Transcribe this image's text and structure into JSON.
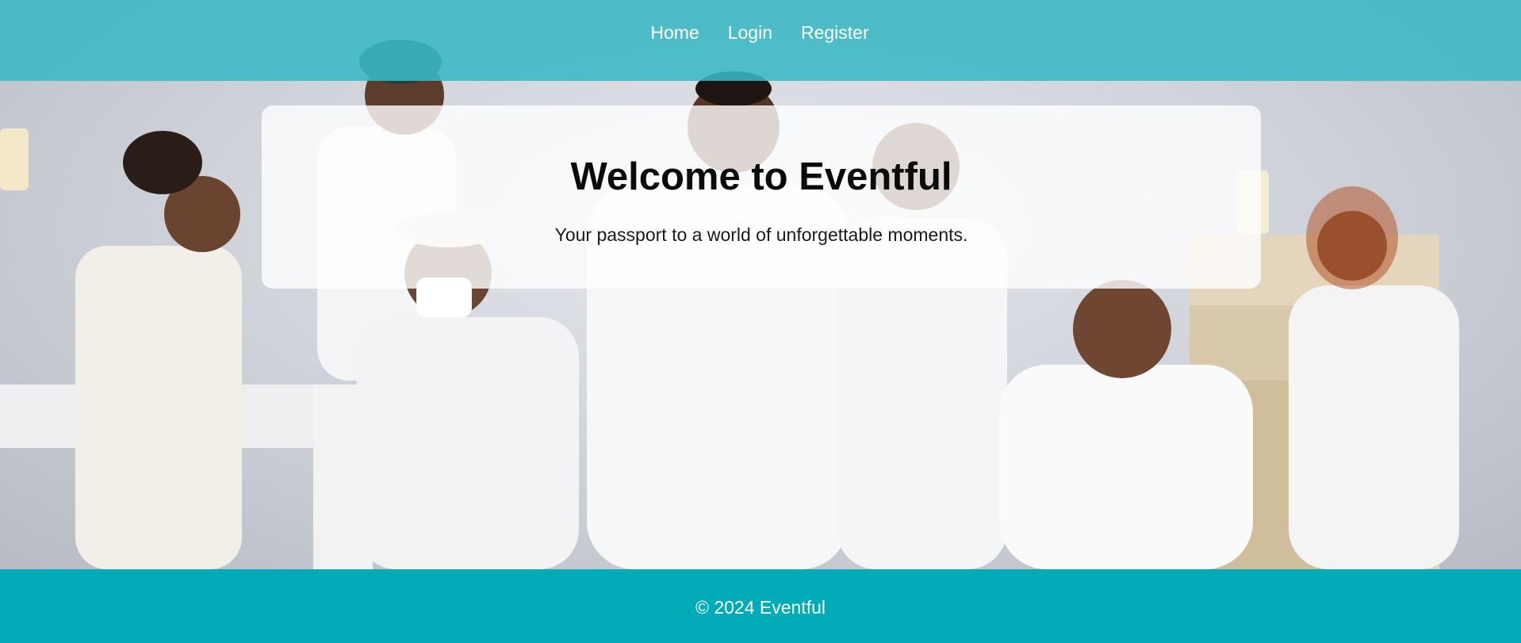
{
  "nav": {
    "links": [
      {
        "label": "Home"
      },
      {
        "label": "Login"
      },
      {
        "label": "Register"
      }
    ]
  },
  "hero": {
    "title": "Welcome to Eventful",
    "subtitle": "Your passport to a world of unforgettable moments.",
    "image_description_icon": "group-photo-icon"
  },
  "footer": {
    "text": "© 2024 Eventful"
  },
  "colors": {
    "navbar": "#3ab8c4",
    "footer": "#00abb8",
    "text_light": "#ffffff",
    "title": "#0b0b0b"
  }
}
